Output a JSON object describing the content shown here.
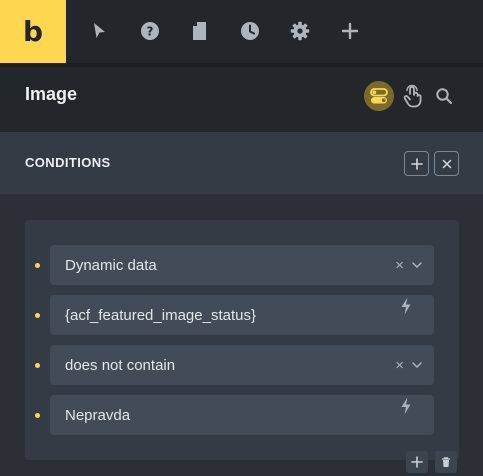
{
  "app": {
    "logo_letter": "b",
    "brand_color": "#ffd64f"
  },
  "toolbar": {
    "icons": [
      "pointer-icon",
      "help-icon",
      "page-icon",
      "history-icon",
      "settings-icon",
      "plus-icon"
    ]
  },
  "panel": {
    "title": "Image"
  },
  "section": {
    "title": "CONDITIONS"
  },
  "conditions": [
    {
      "value": "Dynamic data",
      "kind": "select"
    },
    {
      "value": "{acf_featured_image_status}",
      "kind": "text-dynamic"
    },
    {
      "value": "does not contain",
      "kind": "select"
    },
    {
      "value": "Nepravda",
      "kind": "text-dynamic"
    }
  ],
  "glyphs": {
    "clear": "×",
    "plus": "+"
  }
}
